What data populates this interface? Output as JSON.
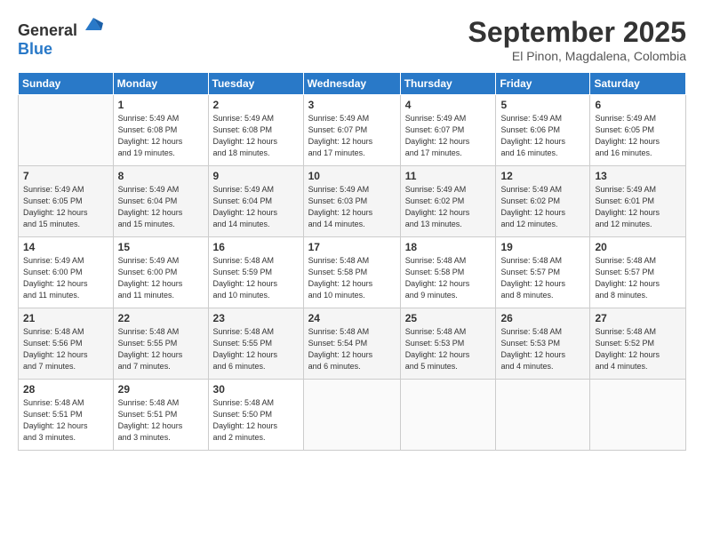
{
  "header": {
    "logo_general": "General",
    "logo_blue": "Blue",
    "month": "September 2025",
    "location": "El Pinon, Magdalena, Colombia"
  },
  "weekdays": [
    "Sunday",
    "Monday",
    "Tuesday",
    "Wednesday",
    "Thursday",
    "Friday",
    "Saturday"
  ],
  "weeks": [
    [
      {
        "day": "",
        "info": ""
      },
      {
        "day": "1",
        "info": "Sunrise: 5:49 AM\nSunset: 6:08 PM\nDaylight: 12 hours\nand 19 minutes."
      },
      {
        "day": "2",
        "info": "Sunrise: 5:49 AM\nSunset: 6:08 PM\nDaylight: 12 hours\nand 18 minutes."
      },
      {
        "day": "3",
        "info": "Sunrise: 5:49 AM\nSunset: 6:07 PM\nDaylight: 12 hours\nand 17 minutes."
      },
      {
        "day": "4",
        "info": "Sunrise: 5:49 AM\nSunset: 6:07 PM\nDaylight: 12 hours\nand 17 minutes."
      },
      {
        "day": "5",
        "info": "Sunrise: 5:49 AM\nSunset: 6:06 PM\nDaylight: 12 hours\nand 16 minutes."
      },
      {
        "day": "6",
        "info": "Sunrise: 5:49 AM\nSunset: 6:05 PM\nDaylight: 12 hours\nand 16 minutes."
      }
    ],
    [
      {
        "day": "7",
        "info": "Sunrise: 5:49 AM\nSunset: 6:05 PM\nDaylight: 12 hours\nand 15 minutes."
      },
      {
        "day": "8",
        "info": "Sunrise: 5:49 AM\nSunset: 6:04 PM\nDaylight: 12 hours\nand 15 minutes."
      },
      {
        "day": "9",
        "info": "Sunrise: 5:49 AM\nSunset: 6:04 PM\nDaylight: 12 hours\nand 14 minutes."
      },
      {
        "day": "10",
        "info": "Sunrise: 5:49 AM\nSunset: 6:03 PM\nDaylight: 12 hours\nand 14 minutes."
      },
      {
        "day": "11",
        "info": "Sunrise: 5:49 AM\nSunset: 6:02 PM\nDaylight: 12 hours\nand 13 minutes."
      },
      {
        "day": "12",
        "info": "Sunrise: 5:49 AM\nSunset: 6:02 PM\nDaylight: 12 hours\nand 12 minutes."
      },
      {
        "day": "13",
        "info": "Sunrise: 5:49 AM\nSunset: 6:01 PM\nDaylight: 12 hours\nand 12 minutes."
      }
    ],
    [
      {
        "day": "14",
        "info": "Sunrise: 5:49 AM\nSunset: 6:00 PM\nDaylight: 12 hours\nand 11 minutes."
      },
      {
        "day": "15",
        "info": "Sunrise: 5:49 AM\nSunset: 6:00 PM\nDaylight: 12 hours\nand 11 minutes."
      },
      {
        "day": "16",
        "info": "Sunrise: 5:48 AM\nSunset: 5:59 PM\nDaylight: 12 hours\nand 10 minutes."
      },
      {
        "day": "17",
        "info": "Sunrise: 5:48 AM\nSunset: 5:58 PM\nDaylight: 12 hours\nand 10 minutes."
      },
      {
        "day": "18",
        "info": "Sunrise: 5:48 AM\nSunset: 5:58 PM\nDaylight: 12 hours\nand 9 minutes."
      },
      {
        "day": "19",
        "info": "Sunrise: 5:48 AM\nSunset: 5:57 PM\nDaylight: 12 hours\nand 8 minutes."
      },
      {
        "day": "20",
        "info": "Sunrise: 5:48 AM\nSunset: 5:57 PM\nDaylight: 12 hours\nand 8 minutes."
      }
    ],
    [
      {
        "day": "21",
        "info": "Sunrise: 5:48 AM\nSunset: 5:56 PM\nDaylight: 12 hours\nand 7 minutes."
      },
      {
        "day": "22",
        "info": "Sunrise: 5:48 AM\nSunset: 5:55 PM\nDaylight: 12 hours\nand 7 minutes."
      },
      {
        "day": "23",
        "info": "Sunrise: 5:48 AM\nSunset: 5:55 PM\nDaylight: 12 hours\nand 6 minutes."
      },
      {
        "day": "24",
        "info": "Sunrise: 5:48 AM\nSunset: 5:54 PM\nDaylight: 12 hours\nand 6 minutes."
      },
      {
        "day": "25",
        "info": "Sunrise: 5:48 AM\nSunset: 5:53 PM\nDaylight: 12 hours\nand 5 minutes."
      },
      {
        "day": "26",
        "info": "Sunrise: 5:48 AM\nSunset: 5:53 PM\nDaylight: 12 hours\nand 4 minutes."
      },
      {
        "day": "27",
        "info": "Sunrise: 5:48 AM\nSunset: 5:52 PM\nDaylight: 12 hours\nand 4 minutes."
      }
    ],
    [
      {
        "day": "28",
        "info": "Sunrise: 5:48 AM\nSunset: 5:51 PM\nDaylight: 12 hours\nand 3 minutes."
      },
      {
        "day": "29",
        "info": "Sunrise: 5:48 AM\nSunset: 5:51 PM\nDaylight: 12 hours\nand 3 minutes."
      },
      {
        "day": "30",
        "info": "Sunrise: 5:48 AM\nSunset: 5:50 PM\nDaylight: 12 hours\nand 2 minutes."
      },
      {
        "day": "",
        "info": ""
      },
      {
        "day": "",
        "info": ""
      },
      {
        "day": "",
        "info": ""
      },
      {
        "day": "",
        "info": ""
      }
    ]
  ]
}
